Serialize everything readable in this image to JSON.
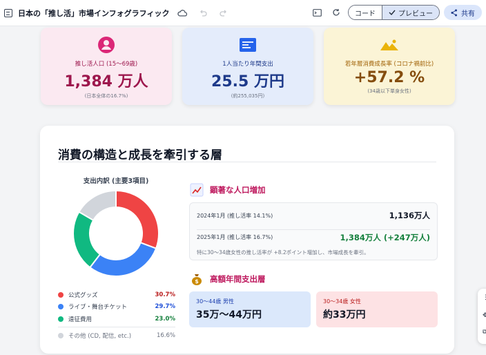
{
  "app": {
    "title": "日本の「推し活」市場インフォグラフィック"
  },
  "toolbar": {
    "code_label": "コード",
    "preview_label": "プレビュー",
    "share_label": "共有"
  },
  "stats": [
    {
      "label": "推し活人口 (15〜69歳)",
      "value": "1,384 万人",
      "note": "(日本全体の16.7%)",
      "icon": "person-circle-icon",
      "color": "#db2777"
    },
    {
      "label": "1人当たり年間支出",
      "value": "25.5 万円",
      "note": "(約255,035円)",
      "icon": "card-list-icon",
      "color": "#2563eb"
    },
    {
      "label": "若年層消費成長率 (コロナ禍前比)",
      "value": "+57.2 %",
      "note": "(34歳以下単身女性)",
      "icon": "mountain-icon",
      "color": "#eab308"
    }
  ],
  "section": {
    "title": "消費の構造と成長を牽引する層"
  },
  "pie": {
    "title": "支出内訳 (主要3項目)"
  },
  "chart_data": {
    "type": "pie",
    "title": "支出内訳 (主要3項目)",
    "categories": [
      "公式グッズ",
      "ライブ・舞台チケット",
      "遠征費用",
      "その他 (CD, 配信, etc.)"
    ],
    "values": [
      30.7,
      29.7,
      23.0,
      16.6
    ],
    "value_labels": [
      "30.7%",
      "29.7%",
      "23.0%",
      "16.6%"
    ],
    "colors": [
      "#ef4444",
      "#3b82f6",
      "#10b981",
      "#d1d5db"
    ],
    "legend": "bottom"
  },
  "population": {
    "heading": "顕著な人口増加",
    "row1_label": "2024年1月 (推し活率 14.1%)",
    "row1_value": "1,136万人",
    "row2_label": "2025年1月 (推し活率 16.7%)",
    "row2_value": "1,384万人 (+247万人)",
    "note": "特に30〜34歳女性の推し活率が +8.2ポイント増加し、市場成長を牽引。"
  },
  "spending": {
    "heading": "高額年間支出層",
    "segments": [
      {
        "label": "30〜44歳 男性",
        "value": "35万〜44万円"
      },
      {
        "label": "30〜34歳 女性",
        "value": "約33万円"
      }
    ]
  }
}
